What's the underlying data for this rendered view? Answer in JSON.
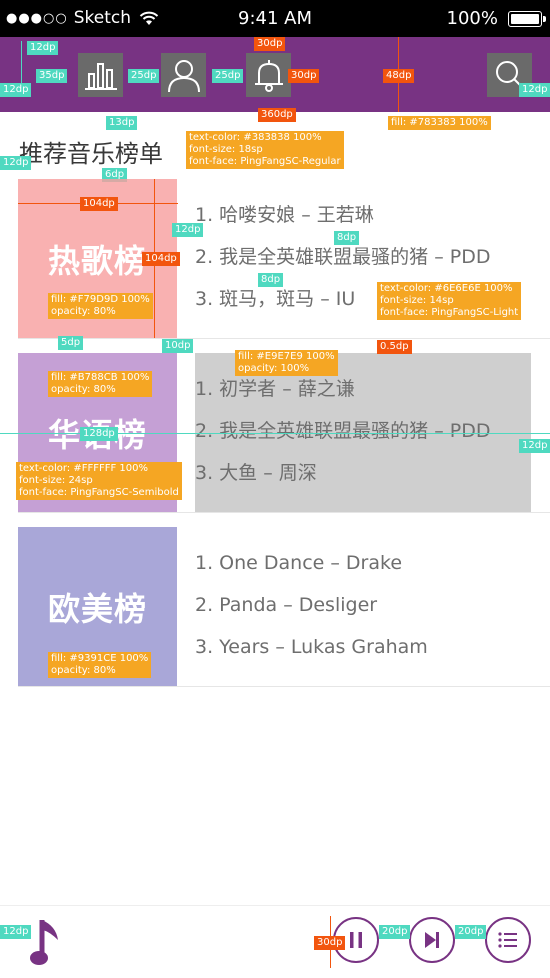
{
  "status_bar": {
    "carrier": "Sketch",
    "time": "9:41 AM",
    "battery": "100%",
    "battery_level": 1.0
  },
  "nav": {
    "background": "#783383",
    "icons": [
      "chart-icon",
      "user-icon",
      "bell-icon",
      "search-icon"
    ]
  },
  "section": {
    "title": "推荐音乐榜单"
  },
  "charts": [
    {
      "name": "热歌榜",
      "fill": "#F79D9D",
      "songs": [
        "1. 哈喽安娘 – 王若琳",
        "2. 我是全英雄联盟最骚的猪 – PDD",
        "3. 斑马，斑马 – IU"
      ]
    },
    {
      "name": "华语榜",
      "fill": "#B788CB",
      "songs": [
        "1. 初学者 – 薛之谦",
        "2. 我是全英雄联盟最骚的猪 – PDD",
        "3. 大鱼 – 周深"
      ]
    },
    {
      "name": "欧美榜",
      "fill": "#9391CE",
      "songs": [
        "1. One Dance – Drake",
        "2. Panda – Desliger",
        "3. Years – Lukas Graham"
      ]
    }
  ],
  "annotations": {
    "dp12_a": "12dp",
    "dp12_b": "12dp",
    "dp35": "35dp",
    "dp25_a": "25dp",
    "dp25_b": "25dp",
    "dp30_top": "30dp",
    "dp30_side": "30dp",
    "dp48": "48dp",
    "dp12_c": "12dp",
    "dp360": "360dp",
    "dp13": "13dp",
    "fill_nav": "fill: #783383 100%",
    "title_color": "text-color: #383838 100%",
    "title_size": "font-size: 18sp",
    "title_face": "font-face: PingFangSC-Regular",
    "dp12_d": "12dp",
    "dp6": "6dp",
    "dp104_w": "104dp",
    "dp12_e": "12dp",
    "dp8_a": "8dp",
    "dp104_h": "104dp",
    "dp8_b": "8dp",
    "song_color": "text-color: #6E6E6E 100%",
    "song_size": "font-size: 14sp",
    "song_face": "font-face: PingFangSC-Light",
    "fill_hot": "fill: #F79D9D 100%",
    "opacity_hot": "opacity: 80%",
    "dp5": "5dp",
    "dp10": "10dp",
    "fill_gray": "fill: #E9E7E9 100%",
    "opacity_gray": "opacity: 100%",
    "dp05": "0.5dp",
    "fill_cn": "fill: #B788CB 100%",
    "opacity_cn": "opacity: 80%",
    "dp128": "128dp",
    "dp12_f": "12dp",
    "cover_color": "text-color: #FFFFFF 100%",
    "cover_size": "font-size: 24sp",
    "cover_face": "font-face: PingFangSC-Semibold",
    "fill_west": "fill: #9391CE 100%",
    "opacity_west": "opacity: 80%",
    "dp12_g": "12dp",
    "dp30_player": "30dp",
    "dp20_a": "20dp",
    "dp20_b": "20dp"
  }
}
